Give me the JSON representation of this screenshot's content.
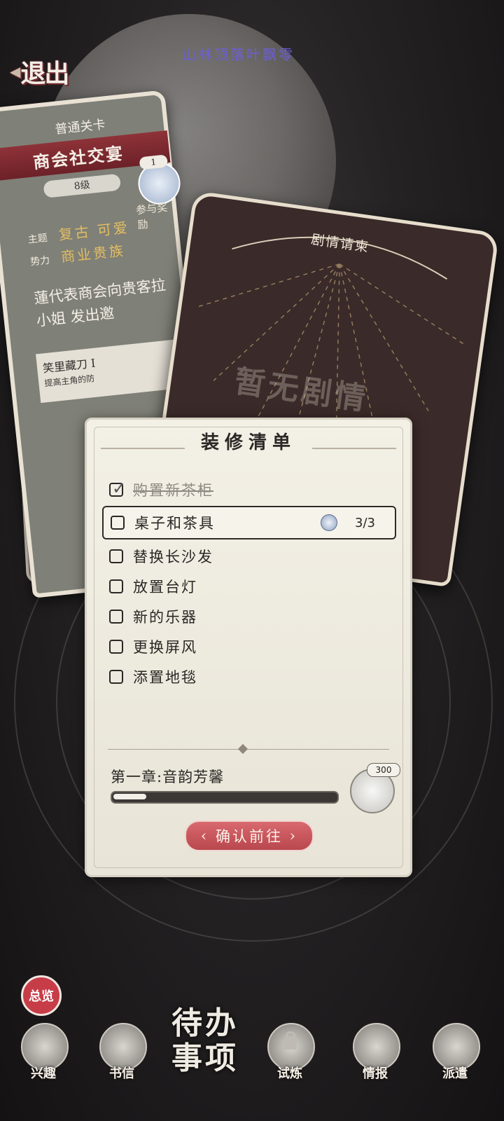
{
  "top": {
    "exit_label": "退出",
    "caption": "山林顶落叶飘零"
  },
  "left_card": {
    "level_type": "普通关卡",
    "title": "商会社交宴",
    "grade": "8级",
    "reward_count": "1",
    "reward_label": "参与奖励",
    "theme_label": "主题",
    "theme_value": "复古 可爱",
    "faction_label": "势力",
    "faction_value": "商业贵族",
    "description": "蓮代表商会向贵客拉小姐 发出邀",
    "skill_name": "笑里藏刀 I",
    "skill_desc": "提高主角的防"
  },
  "right_card": {
    "title": "剧情请柬",
    "faded_text": "暂无剧情"
  },
  "checklist": {
    "title": "装修清单",
    "items": [
      {
        "label": "购置新茶柜",
        "done": true
      },
      {
        "label": "桌子和茶具",
        "done": false,
        "progress": "3/3"
      },
      {
        "label": "替换长沙发",
        "done": false
      },
      {
        "label": "放置台灯",
        "done": false
      },
      {
        "label": "新的乐器",
        "done": false
      },
      {
        "label": "更换屏风",
        "done": false
      },
      {
        "label": "添置地毯",
        "done": false
      }
    ],
    "chapter": "第一章:音韵芳馨",
    "chapter_progress": 0.15,
    "chapter_reward_count": "300",
    "confirm_label": "确认前往"
  },
  "nav": {
    "overview": "总览",
    "center": "待办事项",
    "items": [
      {
        "label": "兴趣",
        "icon": "tea-cup-icon"
      },
      {
        "label": "书信",
        "icon": "letter-icon"
      },
      {
        "label": "试炼",
        "icon": "lock-icon"
      },
      {
        "label": "情报",
        "icon": "map-icon"
      },
      {
        "label": "派遣",
        "icon": "hourglass-icon"
      }
    ]
  },
  "colors": {
    "accent_red": "#b9474e",
    "panel_bg": "#f3f0e6",
    "gold_text": "#e3bd62"
  }
}
